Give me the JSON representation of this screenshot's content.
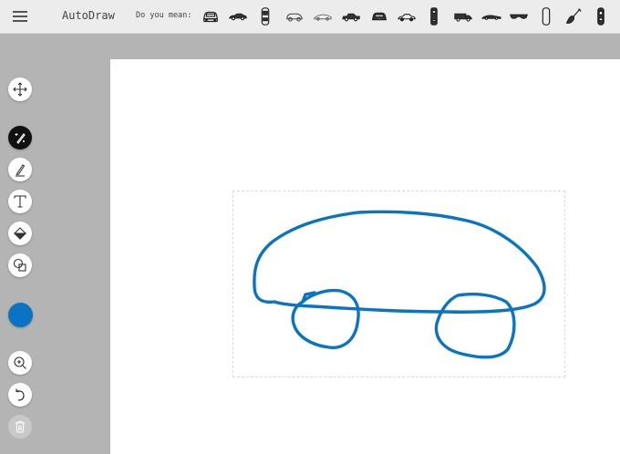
{
  "app": {
    "title": "AutoDraw",
    "suggest_label": "Do you mean:"
  },
  "suggestions": [
    {
      "icon": "suv-front-icon"
    },
    {
      "icon": "sports-car-side-icon"
    },
    {
      "icon": "car-top-view-icon"
    },
    {
      "icon": "small-car-outline-icon"
    },
    {
      "icon": "race-car-outline-icon"
    },
    {
      "icon": "sedan-side-icon"
    },
    {
      "icon": "car-front-icon"
    },
    {
      "icon": "coupe-side-icon"
    },
    {
      "icon": "vertical-car-icon"
    },
    {
      "icon": "truck-side-icon"
    },
    {
      "icon": "low-sports-car-icon"
    },
    {
      "icon": "sunglasses-icon"
    },
    {
      "icon": "phone-outline-icon"
    },
    {
      "icon": "guitar-icon"
    },
    {
      "icon": "car-top-dark-icon"
    }
  ],
  "toolbar": {
    "tools": [
      {
        "name": "move",
        "icon": "move-icon"
      },
      {
        "name": "autodraw",
        "icon": "autodraw-sparkle-pencil-icon",
        "active": true
      },
      {
        "name": "draw",
        "icon": "pencil-icon"
      },
      {
        "name": "type",
        "icon": "text-icon"
      },
      {
        "name": "fill",
        "icon": "fill-bucket-icon"
      },
      {
        "name": "shape",
        "icon": "shapes-icon"
      },
      {
        "name": "zoom",
        "icon": "zoom-in-icon"
      },
      {
        "name": "undo",
        "icon": "undo-icon"
      },
      {
        "name": "delete",
        "icon": "trash-icon",
        "disabled": true
      }
    ],
    "current_color": "#0a74c4"
  },
  "colors": {
    "stroke": "#0a74c4",
    "canvas_bg": "#ffffff",
    "workspace_bg": "#b4b4b4",
    "topbar_bg": "#ececec"
  }
}
